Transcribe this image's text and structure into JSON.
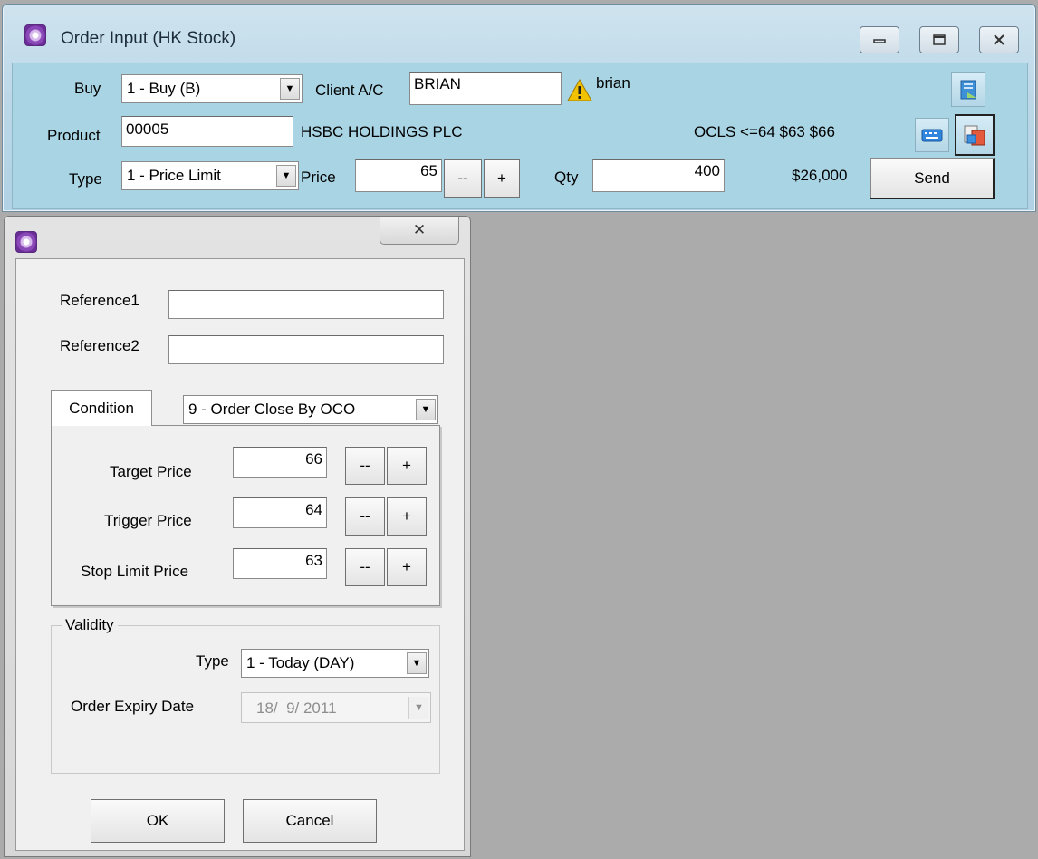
{
  "main_window": {
    "title": "Order Input (HK Stock)",
    "side_label": "Buy",
    "side_value": "1 - Buy (B)",
    "client_label": "Client A/C",
    "client_value": "BRIAN",
    "client_name": "brian",
    "product_label": "Product",
    "product_value": "00005",
    "product_name": "HSBC HOLDINGS PLC",
    "condition_summary": "OCLS <=64 $63 $66",
    "type_label": "Type",
    "type_value": "1 - Price Limit",
    "price_label": "Price",
    "price_value": "65",
    "decrement_label": "--",
    "increment_label": "+",
    "qty_label": "Qty",
    "qty_value": "400",
    "amount": "$26,000",
    "send_label": "Send",
    "icons": [
      "app-icon",
      "minimize-icon",
      "maximize-icon",
      "close-icon",
      "warning-icon",
      "document-icon",
      "keyboard-icon",
      "tools-icon"
    ]
  },
  "dialog": {
    "close_glyph": "✕",
    "reference1_label": "Reference1",
    "reference1_value": "",
    "reference2_label": "Reference2",
    "reference2_value": "",
    "condition_tab": "Condition",
    "condition_value": "9 - Order Close By OCO",
    "target_price_label": "Target Price",
    "target_price_value": "66",
    "trigger_price_label": "Trigger Price",
    "trigger_price_value": "64",
    "stop_limit_label": "Stop Limit Price",
    "stop_limit_value": "63",
    "decrement_label": "--",
    "increment_label": "+",
    "validity_label": "Validity",
    "validity_type_label": "Type",
    "validity_type_value": "1 - Today (DAY)",
    "expiry_label": "Order Expiry Date",
    "expiry_value": "18/  9/ 2011",
    "ok_label": "OK",
    "cancel_label": "Cancel"
  },
  "colors": {
    "main_client_bg": "#a9d4e4",
    "desktop_bg": "#ababab",
    "dialog_bg": "#f0f0f0",
    "warning": "#f2c200"
  }
}
